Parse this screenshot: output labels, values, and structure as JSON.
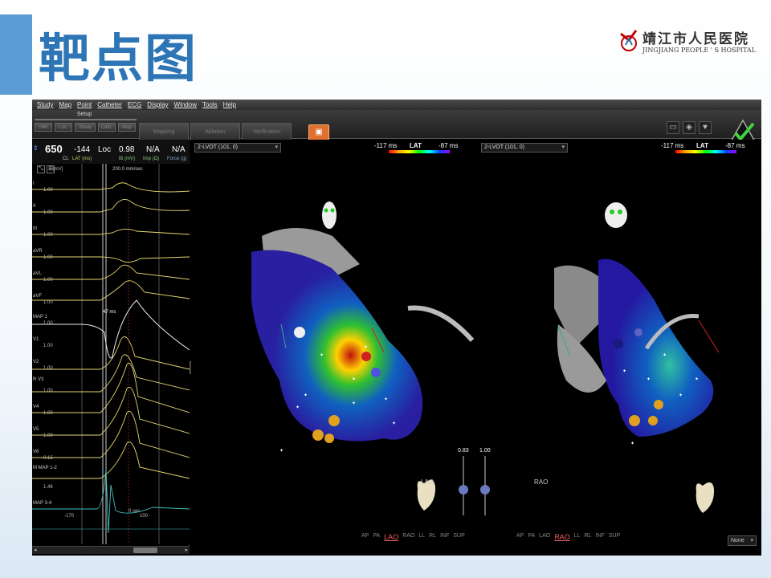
{
  "slide": {
    "title": "靶点图"
  },
  "logo": {
    "name_cn": "靖江市人民医院",
    "name_en": "JINGJIANG PEOPLE ' S HOSPITAL"
  },
  "menu": [
    "Study",
    "Map",
    "Point",
    "Catheter",
    "ECG",
    "Display",
    "Window",
    "Tools",
    "Help"
  ],
  "toolbar": {
    "setup_label": "Setup",
    "setup_buttons": [
      "HW",
      "Loc.",
      "Study",
      "Cath.",
      "Map"
    ],
    "mode_buttons": [
      "Mapping",
      "Ablation",
      "Verification"
    ]
  },
  "ecg": {
    "cycle_length": {
      "value": "650",
      "label": "CL"
    },
    "lat": {
      "value": "-144",
      "label": "LAT (ms)"
    },
    "loc": {
      "value": "Loc",
      "label": ""
    },
    "bipolar": {
      "value": "0.98",
      "label": "Bi (mV)"
    },
    "impedance": {
      "value": "N/A",
      "label": "Imp (Ω)"
    },
    "force": {
      "value": "N/A",
      "label": "Force (g)"
    },
    "sweep_speed": "200.0 mm/sec",
    "unit": "[mV]",
    "annotation_ms": "47 ms",
    "leads": [
      {
        "name": "I",
        "scale": "1.00"
      },
      {
        "name": "II",
        "scale": "1.00"
      },
      {
        "name": "III",
        "scale": "1.00"
      },
      {
        "name": "aVR",
        "scale": "1.00"
      },
      {
        "name": "aVL",
        "scale": "1.00"
      },
      {
        "name": "aVF",
        "scale": "1.00"
      },
      {
        "name": "MAP 1",
        "scale": "1.00"
      },
      {
        "name": "V1",
        "scale": "1.00"
      },
      {
        "name": "V2",
        "scale": "1.00"
      },
      {
        "name": "R V3",
        "scale": "1.00"
      },
      {
        "name": "V4",
        "scale": "1.00"
      },
      {
        "name": "V5",
        "scale": "1.00"
      },
      {
        "name": "V6",
        "scale": "0.15"
      },
      {
        "name": "M MAP 1-2",
        "scale": "1.46"
      },
      {
        "name": "MAP 3-4",
        "scale": ""
      }
    ],
    "time_left": "-170",
    "time_zero": "0 sec",
    "time_right": "100"
  },
  "views": [
    {
      "map_name": "2-LVOT (101, 0)",
      "lat_min": "-117 ms",
      "lat_title": "LAT",
      "lat_max": "-87 ms",
      "labels": [
        "AP",
        "PA",
        "LAO",
        "RAO",
        "LL",
        "RL",
        "INF",
        "SUP"
      ],
      "selected": "LAO",
      "heart_label": "LAO",
      "slider_value": "0.83"
    },
    {
      "map_name": "2-LVOT (101, 0)",
      "lat_min": "-117 ms",
      "lat_title": "LAT",
      "lat_max": "-87 ms",
      "labels": [
        "AP",
        "PA",
        "LAO",
        "RAO",
        "LL",
        "RL",
        "INF",
        "SUP"
      ],
      "selected": "RAO",
      "heart_label": "RAO",
      "slider_value": "1.00"
    }
  ],
  "none_dropdown": "None",
  "colors": {
    "accent": "#5b9bd5",
    "title": "#2e75b6",
    "ecg_surface": "#e8d870",
    "ecg_map": "#40c0c0"
  }
}
